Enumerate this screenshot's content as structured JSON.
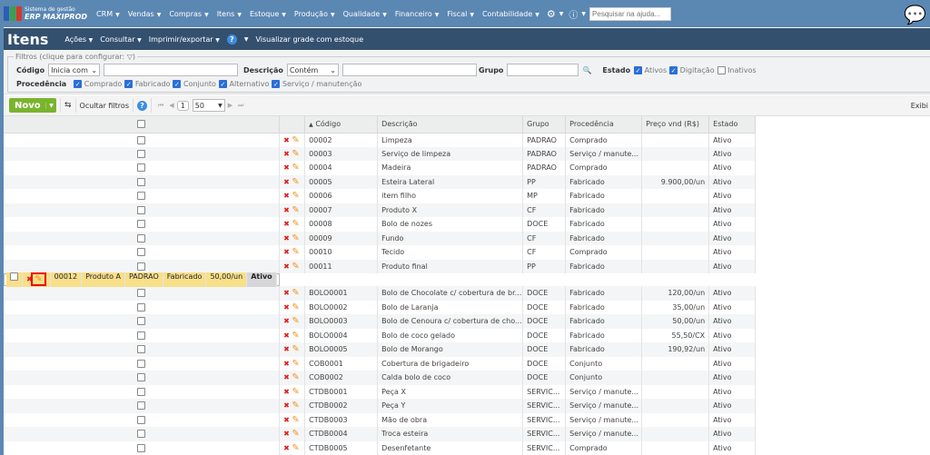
{
  "topbar": {
    "logo_line1": "Sistema de gestão",
    "logo_line2": "ERP MAXIPROD",
    "menu": [
      "CRM",
      "Vendas",
      "Compras",
      "Itens",
      "Estoque",
      "Produção",
      "Qualidade",
      "Financeiro",
      "Fiscal",
      "Contabilidade"
    ],
    "help_placeholder": "Pesquisar na ajuda..."
  },
  "titlebar": {
    "title": "Itens",
    "items": [
      "Ações",
      "Consultar",
      "Imprimir/exportar"
    ],
    "help": "?",
    "grid_link": "Visualizar grade com estoque"
  },
  "filters": {
    "legend": "Filtros (clique para configurar:",
    "legend_end": ")",
    "codigo_label": "Código",
    "codigo_mode": "Inicia com",
    "descricao_label": "Descrição",
    "descricao_mode": "Contém",
    "grupo_label": "Grupo",
    "estado_label": "Estado",
    "estado_options": [
      {
        "label": "Ativos",
        "checked": true
      },
      {
        "label": "Digitação",
        "checked": true
      },
      {
        "label": "Inativos",
        "checked": false
      }
    ],
    "procedencia_label": "Procedência",
    "procedencia_options": [
      {
        "label": "Comprado",
        "checked": true
      },
      {
        "label": "Fabricado",
        "checked": true
      },
      {
        "label": "Conjunto",
        "checked": true
      },
      {
        "label": "Alternativo",
        "checked": true
      },
      {
        "label": "Serviço / manutenção",
        "checked": true
      }
    ]
  },
  "toolbar": {
    "new_label": "Novo",
    "hide_filters": "Ocultar filtros",
    "help": "?",
    "page": "1",
    "page_size": "50",
    "right_text": "Exibi"
  },
  "table": {
    "headers": [
      "Código",
      "Descrição",
      "Grupo",
      "Procedência",
      "Preço vnd (R$)",
      "Estado"
    ],
    "rows": [
      [
        "00002",
        "Limpeza",
        "PADRAO",
        "Comprado",
        "",
        "Ativo"
      ],
      [
        "00003",
        "Serviço de limpeza",
        "PADRAO",
        "Serviço / manute...",
        "",
        "Ativo"
      ],
      [
        "00004",
        "Madeira",
        "PADRAO",
        "Comprado",
        "",
        "Ativo"
      ],
      [
        "00005",
        "Esteira Lateral",
        "PP",
        "Fabricado",
        "9.900,00/un",
        "Ativo"
      ],
      [
        "00006",
        "item filho",
        "MP",
        "Fabricado",
        "",
        "Ativo"
      ],
      [
        "00007",
        "Produto X",
        "CF",
        "Fabricado",
        "",
        "Ativo"
      ],
      [
        "00008",
        "Bolo de nozes",
        "DOCE",
        "Fabricado",
        "",
        "Ativo"
      ],
      [
        "00009",
        "Fundo",
        "CF",
        "Fabricado",
        "",
        "Ativo"
      ],
      [
        "00010",
        "Tecido",
        "CF",
        "Comprado",
        "",
        "Ativo"
      ],
      [
        "00011",
        "Produto final",
        "PP",
        "Fabricado",
        "",
        "Ativo"
      ],
      [
        "00012",
        "Produto A",
        "PADRAO",
        "Fabricado",
        "50,00/un",
        "Ativo"
      ],
      [
        "BOLO0001",
        "Bolo de Chocolate c/ cobertura de br...",
        "DOCE",
        "Fabricado",
        "120,00/un",
        "Ativo"
      ],
      [
        "BOLO0002",
        "Bolo de Laranja",
        "DOCE",
        "Fabricado",
        "35,00/un",
        "Ativo"
      ],
      [
        "BOLO0003",
        "Bolo de Cenoura c/ cobertura de cho...",
        "DOCE",
        "Fabricado",
        "50,00/un",
        "Ativo"
      ],
      [
        "BOLO0004",
        "Bolo de coco gelado",
        "DOCE",
        "Fabricado",
        "55,50/CX",
        "Ativo"
      ],
      [
        "BOLO0005",
        "Bolo de Morango",
        "DOCE",
        "Fabricado",
        "190,92/un",
        "Ativo"
      ],
      [
        "COB0001",
        "Cobertura de brigadeiro",
        "DOCE",
        "Conjunto",
        "",
        "Ativo"
      ],
      [
        "COB0002",
        "Calda bolo de coco",
        "DOCE",
        "Conjunto",
        "",
        "Ativo"
      ],
      [
        "CTDB0001",
        "Peça X",
        "SERVIC...",
        "Serviço / manute...",
        "",
        "Ativo"
      ],
      [
        "CTDB0002",
        "Peça Y",
        "SERVIC...",
        "Serviço / manute...",
        "",
        "Ativo"
      ],
      [
        "CTDB0003",
        "Mão de obra",
        "SERVIC...",
        "Serviço / manute...",
        "",
        "Ativo"
      ],
      [
        "CTDB0004",
        "Troca esteira",
        "SERVIC...",
        "Serviço / manute...",
        "",
        "Ativo"
      ],
      [
        "CTDB0005",
        "Desenfetante",
        "SERVIC...",
        "Comprado",
        "",
        "Ativo"
      ]
    ],
    "selected_index": 10
  }
}
